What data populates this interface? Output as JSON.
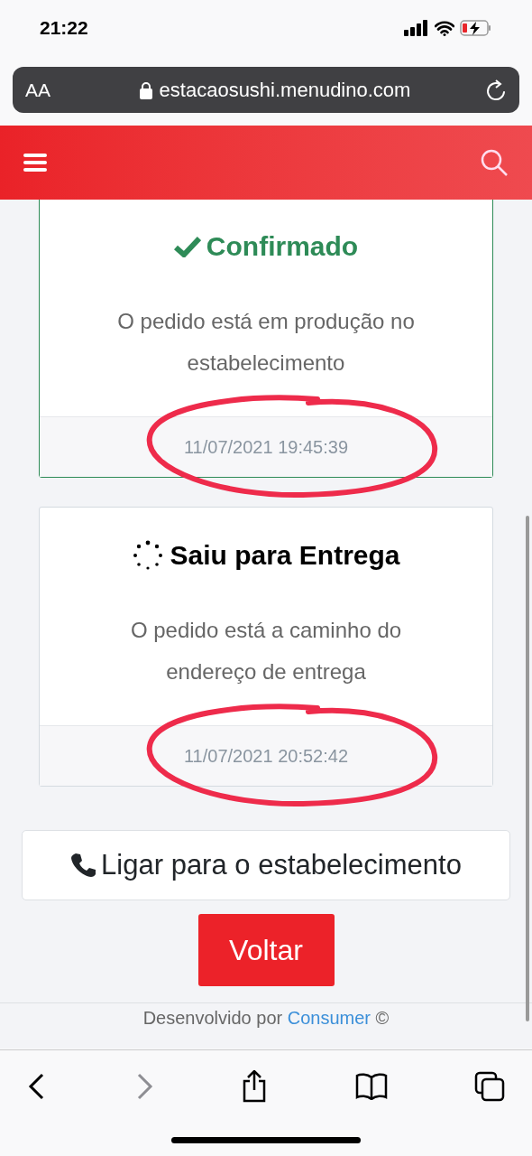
{
  "status_bar": {
    "time": "21:22"
  },
  "address_bar": {
    "text_size_button": "AA",
    "url": "estacaosushi.menudino.com"
  },
  "order_steps": [
    {
      "kind": "confirmed",
      "title": "Confirmado",
      "description": "O pedido está em produção no estabelecimento",
      "timestamp": "11/07/2021 19:45:39",
      "circled": true
    },
    {
      "kind": "in_progress",
      "title": "Saiu para Entrega",
      "description": "O pedido está a caminho do endereço de entrega",
      "timestamp": "11/07/2021 20:52:42",
      "circled": true
    }
  ],
  "call_button": "Ligar para o estabelecimento",
  "back_button": "Voltar",
  "footer": {
    "text": "Desenvolvido por",
    "link": "Consumer",
    "symbol": "©"
  },
  "toolbar": {
    "back_disabled": false,
    "forward_disabled": true
  }
}
